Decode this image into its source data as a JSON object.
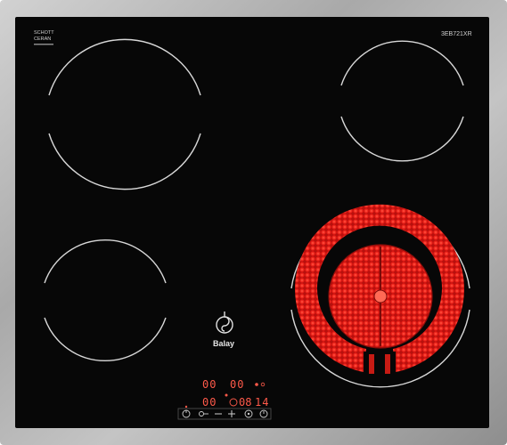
{
  "product": {
    "glass_maker_line1": "SCHOTT",
    "glass_maker_line2": "CERAN",
    "model_code": "3EB721XR",
    "brand": "Balay"
  },
  "zones": [
    {
      "name": "rear-left",
      "state": "off"
    },
    {
      "name": "rear-right",
      "state": "off"
    },
    {
      "name": "front-left",
      "state": "off"
    },
    {
      "name": "front-right-dual",
      "state": "on"
    }
  ],
  "control_panel": {
    "displays": {
      "zone_a": "00",
      "zone_b": "00",
      "zone_c": "00",
      "zone_d": "08",
      "timer": "14"
    },
    "buttons": [
      "power",
      "key-lock",
      "minus",
      "plus",
      "timer",
      "zone-select"
    ]
  },
  "colors": {
    "frame": "#b9b9b9",
    "glass": "#070707",
    "zone_outline": "#d8d8d8",
    "heat_glow": "#e8201a",
    "display_led": "#ff5a4a"
  }
}
